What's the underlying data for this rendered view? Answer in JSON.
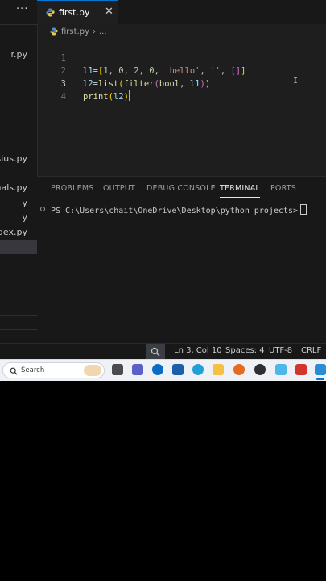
{
  "sidebar": {
    "files": [
      {
        "label": "r.py"
      },
      {
        "label": "sius.py"
      },
      {
        "label": "mals.py"
      },
      {
        "label": "y"
      },
      {
        "label": "y"
      },
      {
        "label": "ndex.py"
      },
      {
        "label": ""
      }
    ]
  },
  "tab": {
    "label": "first.py"
  },
  "breadcrumb": {
    "file": "first.py",
    "rest": "..."
  },
  "editor": {
    "lines": [
      {
        "number": "1"
      },
      {
        "number": "2"
      },
      {
        "number": "3"
      },
      {
        "number": "4"
      }
    ],
    "code": {
      "l1_var": "l1",
      "l1_eq": "=",
      "l1_open": "[",
      "l1_n1": "1",
      "l1_n2": "0",
      "l1_n3": "2",
      "l1_n4": "0",
      "l1_s1": "'hello'",
      "l1_s2": "''",
      "l1_list": "[]",
      "l1_close": "]",
      "l2_var": "l2",
      "l2_eq": "=",
      "l2_list": "list",
      "l2_filter": "filter",
      "l2_bool": "bool",
      "l2_arg": "l1",
      "l2_close1": ")",
      "l2_close2": ")",
      "l3_print": "print",
      "l3_open": "(",
      "l3_arg": "l2",
      "l3_close": ")"
    }
  },
  "panel": {
    "tabs": [
      "PROBLEMS",
      "OUTPUT",
      "DEBUG CONSOLE",
      "TERMINAL",
      "PORTS"
    ],
    "active_tab": "TERMINAL",
    "terminal_prompt": "PS C:\\Users\\chait\\OneDrive\\Desktop\\python projects>"
  },
  "status": {
    "position": "Ln 3, Col 10",
    "spaces": "Spaces: 4",
    "encoding": "UTF-8",
    "eol": "CRLF"
  },
  "taskbar": {
    "search_label": "Search",
    "apps": [
      "file-manager-icon",
      "teams-icon",
      "dell-icon",
      "store-icon",
      "edge-icon",
      "folder-icon",
      "firefox-icon",
      "chrome-icon",
      "notepad-icon",
      "office-icon",
      "vscode-icon"
    ]
  },
  "colors": {
    "editor_bg": "#1e1e1e",
    "accent": "#0078d4",
    "string": "#ce9178",
    "number": "#b5cea8",
    "function": "#dcdcaa"
  }
}
